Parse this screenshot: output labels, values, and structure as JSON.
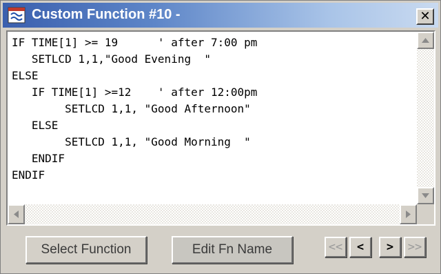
{
  "window": {
    "title": "Custom Function #10 -",
    "close_label": "✕"
  },
  "editor": {
    "lines": [
      "IF TIME[1] >= 19      ' after 7:00 pm",
      "   SETLCD 1,1,\"Good Evening  \"",
      "ELSE",
      "   IF TIME[1] >=12    ' after 12:00pm",
      "        SETLCD 1,1, \"Good Afternoon\"",
      "   ELSE",
      "        SETLCD 1,1, \"Good Morning  \"",
      "   ENDIF",
      "ENDIF"
    ]
  },
  "buttons": {
    "select_function": "Select Function",
    "edit_fn_name": "Edit Fn Name",
    "first": "<<",
    "prev": "<",
    "next": ">",
    "last": ">>"
  },
  "colors": {
    "title_gradient_start": "#3a5fae",
    "title_gradient_end": "#c9daf0",
    "face": "#d4d0c8"
  },
  "icons": {
    "app": "app-window-icon",
    "close": "close-icon",
    "scroll_up": "arrow-up-icon",
    "scroll_down": "arrow-down-icon",
    "scroll_left": "arrow-left-icon",
    "scroll_right": "arrow-right-icon"
  }
}
